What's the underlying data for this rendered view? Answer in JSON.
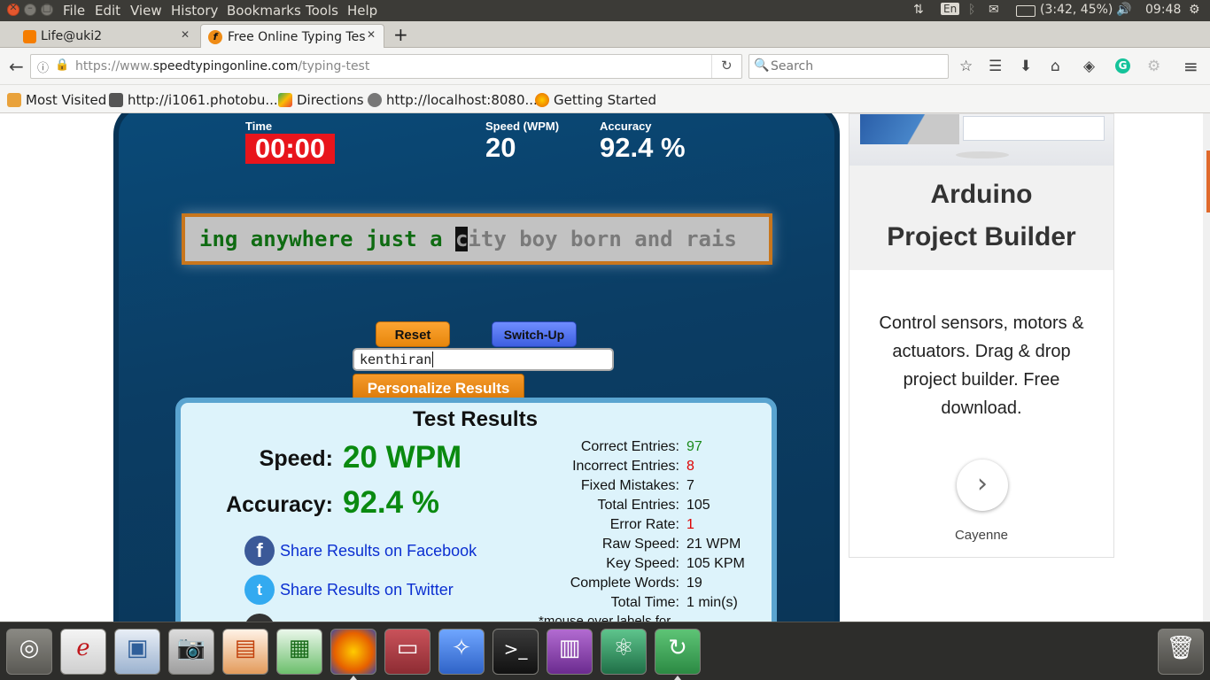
{
  "system": {
    "menus": [
      "File",
      "Edit",
      "View",
      "History",
      "Bookmarks",
      "Tools",
      "Help"
    ],
    "lang": "En",
    "battery": "(3:42, 45%)",
    "time": "09:48"
  },
  "tabs": [
    {
      "title": "Life@uki2",
      "active": false
    },
    {
      "title": "Free Online Typing Tes",
      "active": true
    }
  ],
  "nav": {
    "url_prefix": "https://www.",
    "url_domain": "speedtypingonline.com",
    "url_path": "/typing-test",
    "search_placeholder": "Search"
  },
  "bookmarks": [
    "Most Visited",
    "http://i1061.photobu...",
    "Directions",
    "http://localhost:8080...",
    "Getting Started"
  ],
  "stats": {
    "time_label": "Time",
    "time_value": "00:00",
    "speed_label": "Speed (WPM)",
    "speed_value": "20",
    "accuracy_label": "Accuracy",
    "accuracy_value": "92.4 %"
  },
  "typing": {
    "typed": "ing anywhere just a ",
    "cursor": "c",
    "remaining": "ity boy born and rais"
  },
  "controls": {
    "reset": "Reset",
    "switch_up": "Switch-Up",
    "name_value": "kenthiran",
    "personalize": "Personalize Results"
  },
  "results": {
    "title": "Test Results",
    "speed_label": "Speed:",
    "speed_value": "20 WPM",
    "accuracy_label": "Accuracy:",
    "accuracy_value": "92.4 %",
    "share_facebook": "Share Results on Facebook",
    "share_twitter": "Share Results on Twitter",
    "details": [
      {
        "label": "Correct Entries:",
        "value": "97",
        "tone": "green"
      },
      {
        "label": "Incorrect Entries:",
        "value": "8",
        "tone": "red"
      },
      {
        "label": "Fixed Mistakes:",
        "value": "7",
        "tone": "plain"
      },
      {
        "label": "Total Entries:",
        "value": "105",
        "tone": "plain"
      },
      {
        "label": "Error Rate:",
        "value": "1",
        "tone": "red"
      },
      {
        "label": "Raw Speed:",
        "value": "21 WPM",
        "tone": "plain"
      },
      {
        "label": "Key Speed:",
        "value": "105 KPM",
        "tone": "plain"
      },
      {
        "label": "Complete Words:",
        "value": "19",
        "tone": "plain"
      },
      {
        "label": "Total Time:",
        "value": "1 min(s)",
        "tone": "plain"
      }
    ],
    "footnote": "*mouse over labels for"
  },
  "ad": {
    "title_line1": "Arduino",
    "title_line2": "Project Builder",
    "desc_lines": [
      "Control sensors, motors &",
      "actuators. Drag & drop",
      "project builder. Free",
      "download."
    ],
    "brand": "Cayenne"
  },
  "colors": {
    "panel": "#0b3d64",
    "timer": "#e8151c",
    "typed": "#0f6b12",
    "accent_orange": "#e7860b",
    "switch_blue": "#3d5fe0",
    "result_green": "#0a8a10"
  }
}
